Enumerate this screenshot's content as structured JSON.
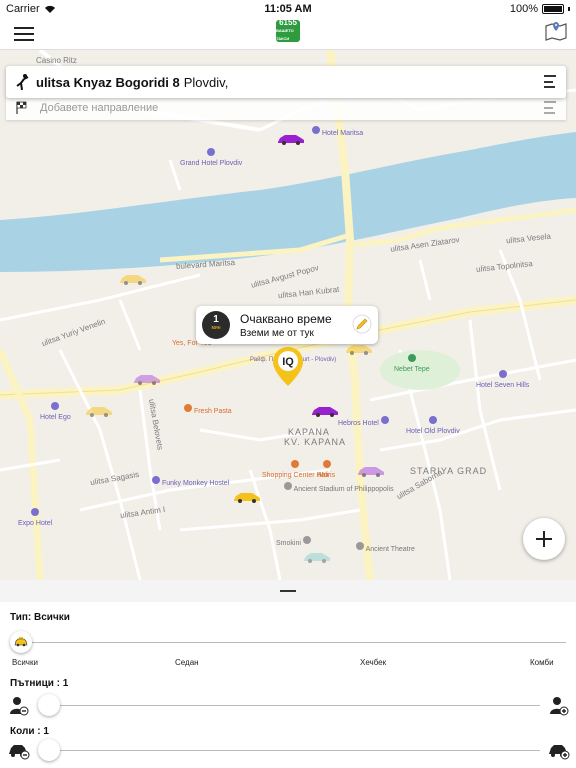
{
  "status_bar": {
    "carrier": "Carrier",
    "time": "11:05 AM",
    "battery": "100%"
  },
  "nav": {
    "logo_text": "6155",
    "logo_sub": "ВАШЕТО ТАКСИ"
  },
  "pickup": {
    "street": "ulitsa Knyaz Bogoridi 8",
    "city": "Plovdiv,"
  },
  "destination": {
    "placeholder": "Добавете направление"
  },
  "eta": {
    "minutes": "1",
    "unit": "мин",
    "title": "Очаквано време",
    "subtitle": "Вземи ме от тук"
  },
  "map": {
    "labels": [
      "Casino Ritz",
      "Grand Hotel Plovdiv",
      "Hotel Maritsa",
      "ulitsa Asen Zlatarov",
      "ulitsa Vesela",
      "ulitsa Topolnitsa",
      "bulevard Maritsa",
      "ulitsa Han Kubrat",
      "ulitsa Yuriy Venelin",
      "Yes, For You",
      "Hotel Ego",
      "Fresh Pasta",
      "Nebet Tepe",
      "Hotel Seven Hills",
      "Hebros Hotel",
      "Hotel Old Plovdiv",
      "KAPANA",
      "KV. KAPANA",
      "STARIYA GRAD",
      "Funky Monkey Hostel",
      "Shopping Center Hali",
      "Moris",
      "Ancient Stadium of Philippopolis",
      "Smokini",
      "Ancient Theatre",
      "Expo Hotel",
      "ulitsa Saborna",
      "ulitsa Sagasis",
      "ulitsa Avgust Popov",
      "ulitsa Antim I",
      "ulitsa Belovets",
      "Райф. Пл. (Re... court - Plovdiv)"
    ]
  },
  "panel": {
    "type_label": "Тип: Всички",
    "types": [
      "Всички",
      "Седан",
      "Хечбек",
      "Комби"
    ],
    "passengers_label": "Пътници : 1",
    "cars_label": "Коли : 1"
  },
  "colors": {
    "river": "#a9d3e5",
    "road": "#fbf3c2",
    "taxi_yellow": "#f5c21b",
    "taxi_purple": "#9a1fd1",
    "brand_green": "#2e9b3f"
  }
}
